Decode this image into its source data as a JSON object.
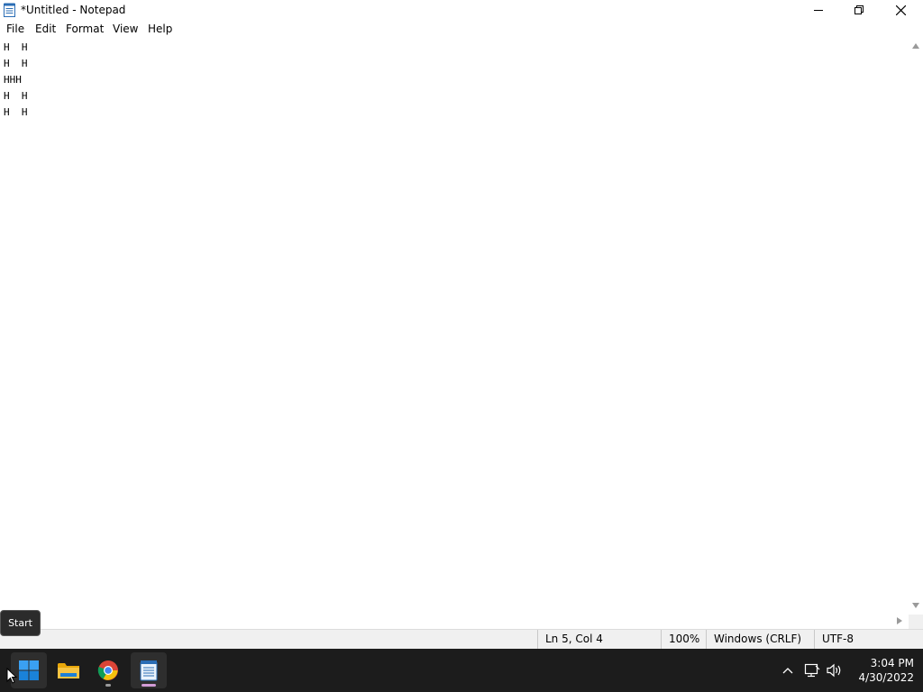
{
  "window": {
    "title": "*Untitled - Notepad"
  },
  "menu": {
    "items": [
      "File",
      "Edit",
      "Format",
      "View",
      "Help"
    ]
  },
  "editor": {
    "content": "H  H\nH  H\nHHH\nH  H\nH  H"
  },
  "status": {
    "position": "Ln 5, Col 4",
    "zoom": "100%",
    "line_ending": "Windows (CRLF)",
    "encoding": "UTF-8"
  },
  "tooltip": {
    "text": "Start"
  },
  "taskbar": {
    "apps": [
      "start-icon",
      "file-explorer-icon",
      "chrome-icon",
      "notepad-icon"
    ],
    "clock_time": "3:04 PM",
    "clock_date": "4/30/2022"
  },
  "colors": {
    "taskbar_bg": "#1c1c1c",
    "statusbar_bg": "#f0f0f0",
    "accent_blue": "#0078d4"
  }
}
